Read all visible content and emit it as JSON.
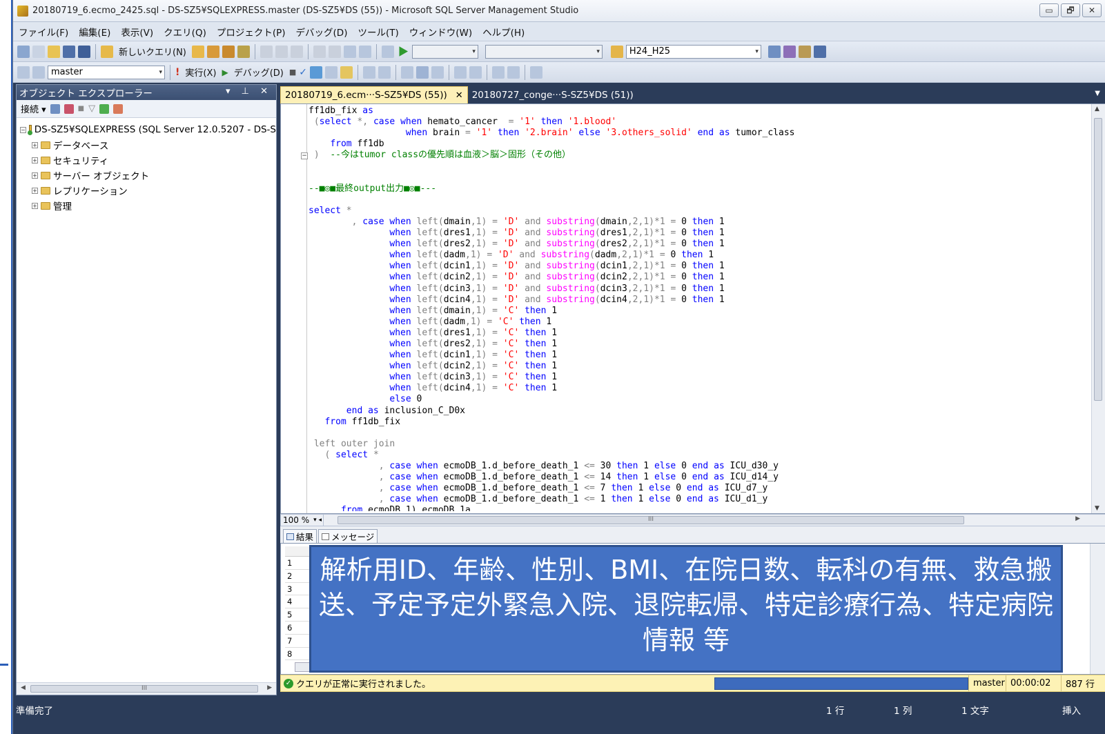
{
  "window": {
    "title": "20180719_6.ecmo_2425.sql - DS-SZ5¥SQLEXPRESS.master (DS-SZ5¥DS (55)) - Microsoft SQL Server Management Studio",
    "btn_min": "▭",
    "btn_restore": "🗗",
    "btn_close": "✕"
  },
  "menu": [
    "ファイル(F)",
    "編集(E)",
    "表示(V)",
    "クエリ(Q)",
    "プロジェクト(P)",
    "デバッグ(D)",
    "ツール(T)",
    "ウィンドウ(W)",
    "ヘルプ(H)"
  ],
  "toolbar1": {
    "new_query": "新しいクエリ(N)",
    "solution_config": "H24_H25"
  },
  "toolbar2": {
    "database": "master",
    "execute": "実行(X)",
    "debug": "デバッグ(D)"
  },
  "object_explorer": {
    "title": "オブジェクト エクスプローラー",
    "controls": "▾ ⊥ ✕",
    "connect": "接続 ▾",
    "server": "DS-SZ5¥SQLEXPRESS (SQL Server 12.0.5207 - DS-S",
    "nodes": [
      "データベース",
      "セキュリティ",
      "サーバー オブジェクト",
      "レプリケーション",
      "管理"
    ]
  },
  "tabs": {
    "active": "20180719_6.ecm···S-SZ5¥DS (55))",
    "inactive": "20180727_conge···S-SZ5¥DS (51))"
  },
  "editor": {
    "zoom": "100 %",
    "hscroll_grip": "III"
  },
  "results_tabs": {
    "results": "結果",
    "messages": "メッセージ"
  },
  "row_numbers": [
    "1",
    "2",
    "3",
    "4",
    "5",
    "6",
    "7",
    "8"
  ],
  "status": {
    "message": "クエリが正常に実行されました。",
    "database": "master",
    "elapsed": "00:00:02",
    "rows": "887 行"
  },
  "bottom_bar": {
    "ready": "準備完了",
    "line": "1 行",
    "col": "1 列",
    "ch": "1 文字",
    "mode": "挿入"
  },
  "overlay": {
    "text": "解析用ID、年齢、性別、BMI、在院日数、転科の有無、救急搬送、予定予定外緊急入院、退院転帰、特定診療行為、特定病院情報 等"
  },
  "colors": {
    "frame": "#2b3c59",
    "active_tab": "#fdf0b8",
    "overlay": "#4472c4",
    "keyword": "#0000ff",
    "string": "#ff0000",
    "function": "#ff00ff",
    "comment": "#008000"
  }
}
